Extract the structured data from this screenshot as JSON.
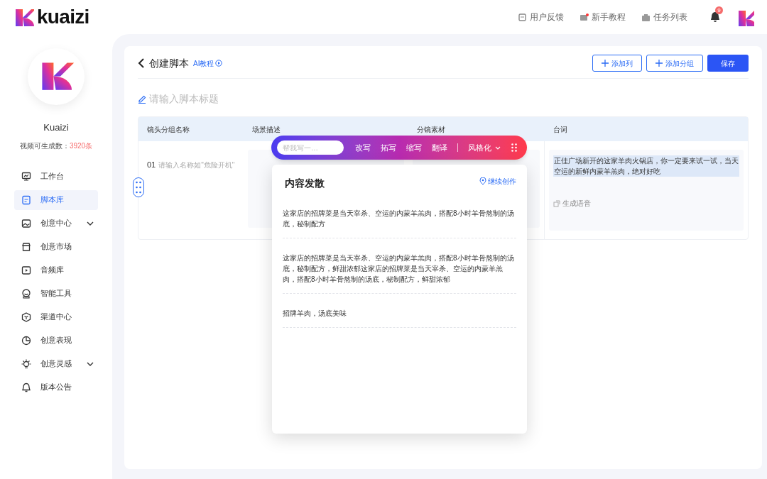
{
  "header": {
    "logo": "kuaizi",
    "links": [
      {
        "label": "用户反馈",
        "kind": "feedback"
      },
      {
        "label": "新手教程",
        "kind": "tutorial"
      },
      {
        "label": "任务列表",
        "kind": "tasks"
      }
    ],
    "notification_count": "9"
  },
  "sidebar": {
    "account": "Kuaizi",
    "quota_label": "视频可生成数：",
    "quota_value": "3920条",
    "items": [
      {
        "label": "工作台",
        "selected": false,
        "expandable": false
      },
      {
        "label": "脚本库",
        "selected": true,
        "expandable": false
      },
      {
        "label": "创意中心",
        "selected": false,
        "expandable": true
      },
      {
        "label": "创意市场",
        "selected": false,
        "expandable": false
      },
      {
        "label": "音频库",
        "selected": false,
        "expandable": false
      },
      {
        "label": "智能工具",
        "selected": false,
        "expandable": false
      },
      {
        "label": "渠道中心",
        "selected": false,
        "expandable": false
      },
      {
        "label": "创意表现",
        "selected": false,
        "expandable": false
      },
      {
        "label": "创意灵感",
        "selected": false,
        "expandable": true
      },
      {
        "label": "版本公告",
        "selected": false,
        "expandable": false
      }
    ]
  },
  "page": {
    "title": "创建脚本",
    "help_link": "AI教程",
    "buttons": [
      {
        "label": "添加列",
        "kind": "add"
      },
      {
        "label": "添加分组",
        "kind": "add"
      },
      {
        "label": "保存",
        "kind": "primary"
      }
    ],
    "title_placeholder": "请输入脚本标题",
    "table": {
      "columns": [
        "镜头分组名称",
        "场景描述",
        "分镜素材",
        "台词"
      ],
      "rows": [
        {
          "index": "01",
          "name_placeholder": "请输入名称如\"危险开机\"",
          "lines": "正佳广场新开的这家羊肉火锅店，你一定要来试一试，当天空运的新鲜内蒙羊羔肉，绝对好吃",
          "voice_button": "生成语音"
        }
      ]
    }
  },
  "toolbar": {
    "placeholder": "帮我写一…",
    "actions": [
      "改写",
      "拓写",
      "缩写",
      "翻译"
    ],
    "style_menu": "风格化"
  },
  "popup": {
    "title": "内容发散",
    "action": "继续创作",
    "items": [
      "这家店的招牌菜是当天宰杀、空运的内蒙羊羔肉，搭配8小时羊骨熬制的汤底，秘制配方",
      "这家店的招牌菜是当天宰杀、空运的内蒙羊羔肉，搭配8小时羊骨熬制的汤底，秘制配方，鲜甜浓郁这家店的招牌菜是当天宰杀、空运的内蒙羊羔肉，搭配8小时羊骨熬制的汤底，秘制配方，鲜甜浓郁",
      "招牌羊肉，汤底美味"
    ]
  }
}
